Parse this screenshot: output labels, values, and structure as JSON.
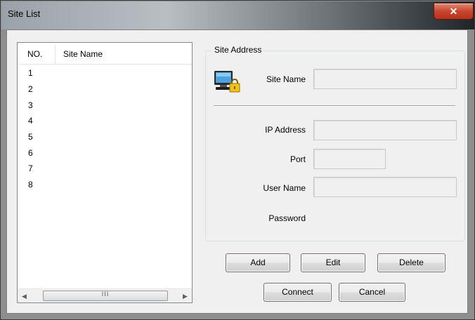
{
  "window": {
    "title": "Site List",
    "close_glyph": "✕"
  },
  "list": {
    "columns": [
      "NO.",
      "Site Name"
    ],
    "rows": [
      "1",
      "2",
      "3",
      "4",
      "5",
      "6",
      "7",
      "8"
    ],
    "scroll_left": "◀",
    "scroll_right": "▶",
    "scroll_grip": "III"
  },
  "address_group": {
    "title": "Site Address",
    "icon": "computer-lock-icon",
    "site_name_label": "Site Name",
    "ip_label": "IP Address",
    "port_label": "Port",
    "user_label": "User Name",
    "password_label": "Password",
    "site_name_value": "",
    "ip_value": "",
    "port_value": "",
    "user_value": ""
  },
  "buttons": {
    "add": "Add",
    "edit": "Edit",
    "delete": "Delete",
    "connect": "Connect",
    "cancel": "Cancel"
  }
}
